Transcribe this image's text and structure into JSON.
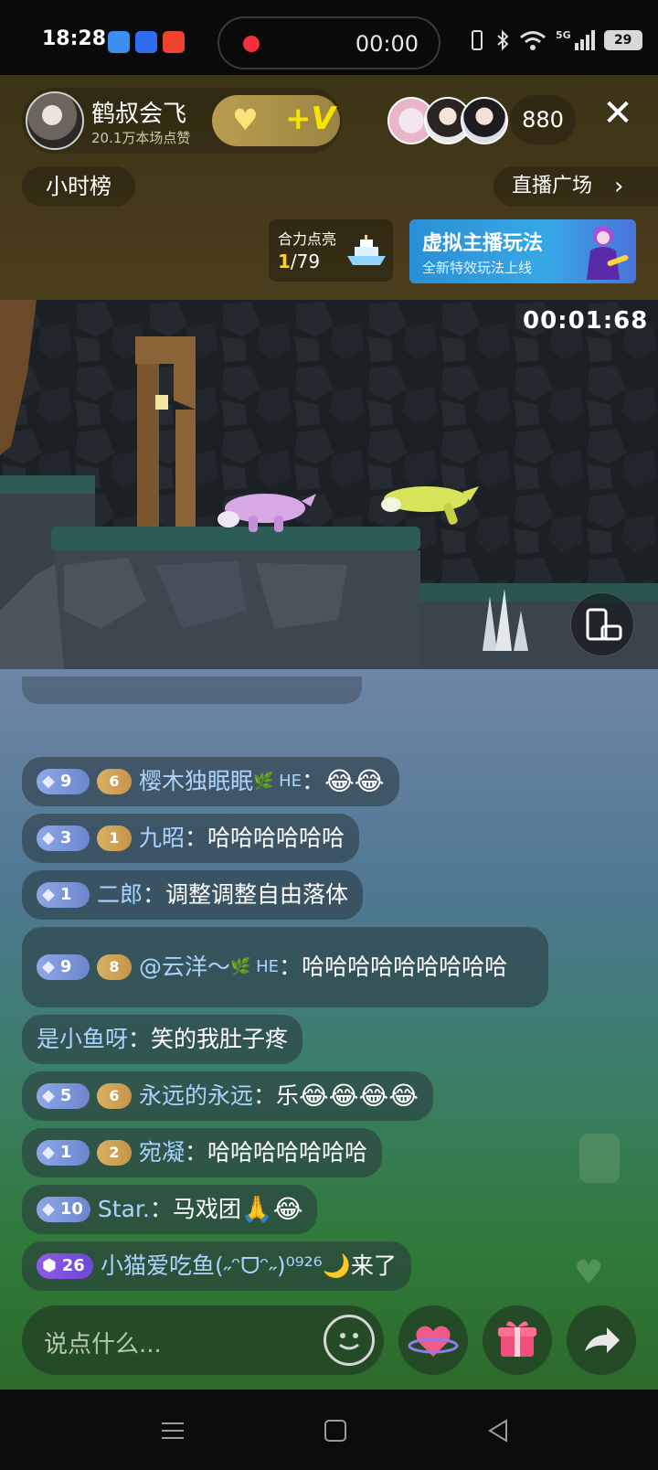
{
  "status_bar": {
    "time": "18:28",
    "recording_time": "00:00",
    "battery": "29",
    "network": "5G"
  },
  "host": {
    "name": "鹤叔会飞",
    "likes": "20.1万本场点赞",
    "follow_badge": "+V"
  },
  "viewers": {
    "count": "880"
  },
  "rank": {
    "hourly_label": "小时榜"
  },
  "live_square": {
    "label": "直播广场",
    "chevron": "›"
  },
  "task": {
    "title": "合力点亮",
    "current": "1",
    "total": "/79"
  },
  "virtual_banner": {
    "title": "虚拟主播玩法",
    "subtitle": "全新特效玩法上线"
  },
  "game": {
    "timer": "00:01:68"
  },
  "chat": [
    {
      "level": "9",
      "fan": "6",
      "name": "樱木独眠眠",
      "name_suffix": "🌿 HE",
      "sep": "：",
      "text": "",
      "emoji": "😂😂"
    },
    {
      "level": "3",
      "fan": "1",
      "name": "九昭",
      "sep": "：",
      "text": "哈哈哈哈哈哈",
      "emoji": ""
    },
    {
      "level": "1",
      "fan": "",
      "name": "二郎",
      "sep": "：",
      "text": "调整调整自由落体",
      "emoji": ""
    },
    {
      "level": "9",
      "fan": "8",
      "name": "@云洋～",
      "name_suffix": "🌿 HE",
      "sep": "：",
      "text": "哈哈哈哈哈哈哈哈哈",
      "emoji": ""
    },
    {
      "level": "",
      "fan": "",
      "name": "是小鱼呀",
      "sep": "：",
      "text": "笑的我肚子疼",
      "emoji": ""
    },
    {
      "level": "5",
      "fan": "6",
      "name": "永远的永远",
      "sep": "：",
      "text": "乐",
      "emoji": "😂😂😂😂"
    },
    {
      "level": "1",
      "fan": "2",
      "name": "宛凝",
      "sep": "：",
      "text": "哈哈哈哈哈哈哈",
      "emoji": ""
    },
    {
      "level": "10",
      "fan": "",
      "name": "Star.",
      "sep": "：",
      "text": "马戏团",
      "emoji": "🙏😂"
    },
    {
      "level": "26",
      "fan": "",
      "name": "小猫爱吃鱼(˶ᵔᗜᵔ˶)⁰⁹²⁶🌙",
      "sep": "",
      "text": " 来了",
      "emoji": ""
    }
  ],
  "input": {
    "placeholder": "说点什么..."
  },
  "icons": {
    "emoji": "emoji-icon",
    "heart": "heart-planet-icon",
    "gift": "gift-icon",
    "share": "share-arrow-icon"
  },
  "colors": {
    "header_bg": "#45391a",
    "username": "#a9d4ff",
    "level_badge": "#7f98dc",
    "fan_badge": "#d0a458",
    "record_dot": "#f4303a"
  }
}
